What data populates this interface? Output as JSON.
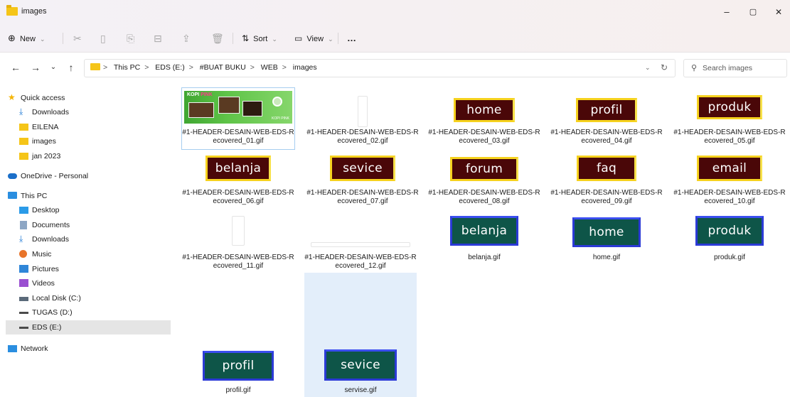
{
  "window": {
    "title": "images",
    "controls": {
      "minimize": "–",
      "maximize": "▢",
      "close": "✕"
    }
  },
  "toolbar": {
    "new_label": "New",
    "sort_label": "Sort",
    "view_label": "View",
    "more_label": "…"
  },
  "address": {
    "crumbs": [
      "This PC",
      "EDS (E:)",
      "#BUAT BUKU",
      "WEB",
      "images"
    ],
    "separator": ">",
    "search_placeholder": "Search images"
  },
  "sidebar": {
    "items": [
      {
        "label": "Quick access",
        "icon": "star-icon"
      },
      {
        "label": "Downloads",
        "icon": "download-icon"
      },
      {
        "label": "EILENA",
        "icon": "folder-icon"
      },
      {
        "label": "images",
        "icon": "folder-icon"
      },
      {
        "label": "jan 2023",
        "icon": "folder-icon"
      },
      {
        "label": "OneDrive - Personal",
        "icon": "cloud-icon"
      },
      {
        "label": "This PC",
        "icon": "pc-icon"
      },
      {
        "label": "Desktop",
        "icon": "desktop-icon"
      },
      {
        "label": "Documents",
        "icon": "document-icon"
      },
      {
        "label": "Downloads",
        "icon": "download-icon"
      },
      {
        "label": "Music",
        "icon": "music-icon"
      },
      {
        "label": "Pictures",
        "icon": "pictures-icon"
      },
      {
        "label": "Videos",
        "icon": "videos-icon"
      },
      {
        "label": "Local Disk (C:)",
        "icon": "disk-icon"
      },
      {
        "label": "TUGAS (D:)",
        "icon": "drive-icon"
      },
      {
        "label": "EDS (E:)",
        "icon": "drive-icon"
      },
      {
        "label": "Network",
        "icon": "network-icon"
      }
    ],
    "selected": "EDS (E:)"
  },
  "files": [
    {
      "name": "#1-HEADER-DESAIN-WEB-EDS-Recovered_01.gif",
      "kind": "header",
      "header_text": "KOPI ",
      "header_accent": "PINK",
      "header_text2": "KOPI PINK"
    },
    {
      "name": "#1-HEADER-DESAIN-WEB-EDS-Recovered_02.gif",
      "kind": "thin-vertical"
    },
    {
      "name": "#1-HEADER-DESAIN-WEB-EDS-Recovered_03.gif",
      "kind": "brown",
      "text": "home"
    },
    {
      "name": "#1-HEADER-DESAIN-WEB-EDS-Recovered_04.gif",
      "kind": "brown",
      "text": "profil"
    },
    {
      "name": "#1-HEADER-DESAIN-WEB-EDS-Recovered_05.gif",
      "kind": "brown",
      "text": "produk"
    },
    {
      "name": "#1-HEADER-DESAIN-WEB-EDS-Recovered_06.gif",
      "kind": "brown",
      "text": "belanja"
    },
    {
      "name": "#1-HEADER-DESAIN-WEB-EDS-Recovered_07.gif",
      "kind": "brown",
      "text": "sevice"
    },
    {
      "name": "#1-HEADER-DESAIN-WEB-EDS-Recovered_08.gif",
      "kind": "brown",
      "text": "forum"
    },
    {
      "name": "#1-HEADER-DESAIN-WEB-EDS-Recovered_09.gif",
      "kind": "brown",
      "text": "faq"
    },
    {
      "name": "#1-HEADER-DESAIN-WEB-EDS-Recovered_10.gif",
      "kind": "brown",
      "text": "email"
    },
    {
      "name": "#1-HEADER-DESAIN-WEB-EDS-Recovered_11.gif",
      "kind": "thin-vertical"
    },
    {
      "name": "#1-HEADER-DESAIN-WEB-EDS-Recovered_12.gif",
      "kind": "thin-horizontal"
    },
    {
      "name": "belanja.gif",
      "kind": "teal",
      "text": "belanja"
    },
    {
      "name": "home.gif",
      "kind": "teal",
      "text": "home"
    },
    {
      "name": "produk.gif",
      "kind": "teal",
      "text": "produk"
    },
    {
      "name": "profil.gif",
      "kind": "teal",
      "text": "profil"
    },
    {
      "name": "servise.gif",
      "kind": "teal",
      "text": "sevice"
    }
  ],
  "colors": {
    "brown_button": "#4a0708",
    "brown_border": "#f6d21e",
    "teal_button": "#0e5548",
    "teal_border": "#2b3ad6",
    "selection": "#e3eefa",
    "folder": "#f5c518"
  }
}
